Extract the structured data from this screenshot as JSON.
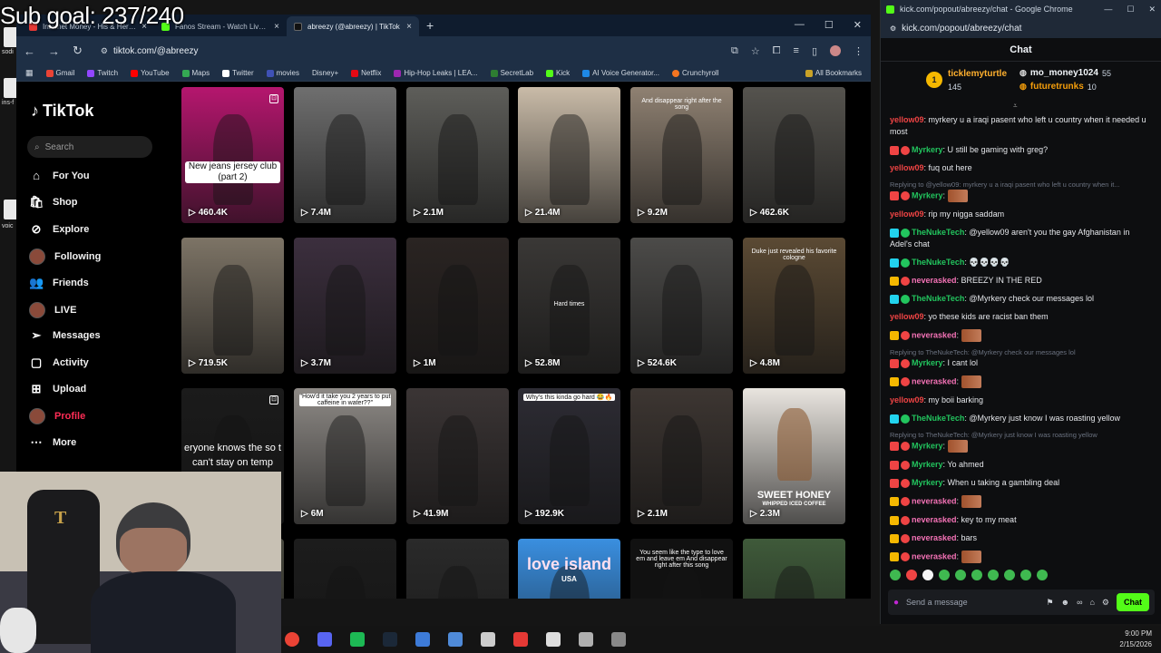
{
  "overlay": {
    "sub_goal": "Sub goal: 237/240"
  },
  "desktop_labels": [
    "ins-f",
    "sodi",
    "voic"
  ],
  "browser": {
    "tabs": [
      {
        "label": "Internet Money - His & Hers ft.",
        "color": "#e53935",
        "active": false
      },
      {
        "label": "Fanos Stream - Watch Live on K",
        "color": "#53fc18",
        "active": false
      },
      {
        "label": "abreezy (@abreezy) | TikTok",
        "color": "#111111",
        "active": true
      }
    ],
    "new_tab": "+",
    "url": "tiktok.com/@abreezy",
    "bookmarks": [
      {
        "label": "Gmail",
        "color": "#ea4335"
      },
      {
        "label": "Twitch",
        "color": "#9146ff"
      },
      {
        "label": "YouTube",
        "color": "#ff0000"
      },
      {
        "label": "Maps",
        "color": "#34a853"
      },
      {
        "label": "Twitter",
        "color": "#ffffff"
      },
      {
        "label": "movies",
        "color": "#3f51b5"
      },
      {
        "label": "Disney+",
        "color": "#113ccf"
      },
      {
        "label": "Netflix",
        "color": "#e50914"
      },
      {
        "label": "Hip-Hop Leaks | LEA...",
        "color": "#9c27b0"
      },
      {
        "label": "SecretLab",
        "color": "#2e7d32"
      },
      {
        "label": "Kick",
        "color": "#53fc18"
      },
      {
        "label": "AI Voice Generator...",
        "color": "#1e88e5"
      },
      {
        "label": "Crunchyroll",
        "color": "#f47521"
      }
    ],
    "all_bookmarks": "All Bookmarks"
  },
  "tiktok": {
    "logo": "TikTok",
    "search_placeholder": "Search",
    "nav": [
      {
        "label": "For You",
        "icon": "home-icon"
      },
      {
        "label": "Shop",
        "icon": "shop-icon"
      },
      {
        "label": "Explore",
        "icon": "compass-icon"
      },
      {
        "label": "Following",
        "icon": "avatar-icon"
      },
      {
        "label": "Friends",
        "icon": "friends-icon"
      },
      {
        "label": "LIVE",
        "icon": "avatar-icon"
      },
      {
        "label": "Messages",
        "icon": "send-icon"
      },
      {
        "label": "Activity",
        "icon": "bell-icon"
      },
      {
        "label": "Upload",
        "icon": "plus-square-icon"
      },
      {
        "label": "Profile",
        "icon": "avatar-icon"
      },
      {
        "label": "More",
        "icon": "more-icon"
      }
    ],
    "videos": [
      {
        "views": "460.4K",
        "bg": "#b5166e",
        "caption": "New jeans jersey club (part 2)"
      },
      {
        "views": "7.4M",
        "bg": "#6f6f6f"
      },
      {
        "views": "2.1M",
        "bg": "#5e5e5a"
      },
      {
        "views": "21.4M",
        "bg": "#c9bba8"
      },
      {
        "views": "9.2M",
        "bg": "#8f8172",
        "top": "And disappear right after the song"
      },
      {
        "views": "462.6K",
        "bg": "#55534e"
      },
      {
        "views": "719.5K",
        "bg": "#7d7466"
      },
      {
        "views": "3.7M",
        "bg": "#3c2f3e"
      },
      {
        "views": "1M",
        "bg": "#2a2422"
      },
      {
        "views": "52.8M",
        "bg": "#3a3836",
        "mid": "Hard times"
      },
      {
        "views": "524.6K",
        "bg": "#4c4b49"
      },
      {
        "views": "4.8M",
        "bg": "#5b4a34",
        "top": "Duke just revealed his favorite cologne"
      },
      {
        "views": "",
        "bg": "#1b1b1b",
        "midwhite": "eryone knows the so t can't stay on temp"
      },
      {
        "views": "6M",
        "bg": "#8e8a86",
        "caption2": "\"How'd it take you 2 years to put caffeine in water??\""
      },
      {
        "views": "41.9M",
        "bg": "#3b3535"
      },
      {
        "views": "192.9K",
        "bg": "#2d2c34",
        "caption2": "Why's this kinda go hard 😂🔥"
      },
      {
        "views": "2.1M",
        "bg": "#3d3632"
      },
      {
        "views": "2.3M",
        "bg": "#e9e5df",
        "big": "SWEET HONEY",
        "small": "WHIPPED ICED COFFEE"
      },
      {
        "views": "",
        "bg": "#49493f"
      },
      {
        "views": "",
        "bg": "#1c1c1c"
      },
      {
        "views": "",
        "bg": "#2a2a2a"
      },
      {
        "views": "",
        "bg": "#3a8fe0",
        "big2": "love island",
        "small2": "USA"
      },
      {
        "views": "",
        "bg": "#111111",
        "top": "You seem like the type to love em and leave em And disappear right after this song"
      },
      {
        "views": "",
        "bg": "#3f5a3a"
      }
    ]
  },
  "chat": {
    "window_title": "kick.com/popout/abreezy/chat - Google Chrome",
    "url": "kick.com/popout/abreezy/chat",
    "header": "Chat",
    "leaderboard": {
      "top": {
        "name": "ticklemyturtle",
        "amount": "145"
      },
      "second": {
        "name": "mo_money1024",
        "amount": "55"
      },
      "third": {
        "name": "futuretrunks",
        "amount": "10"
      }
    },
    "messages": [
      {
        "user": "yellow09",
        "color": "#ef4444",
        "text": ": myrkery u a iraqi pasent who left u country when it needed u most"
      },
      {
        "user": "Myrkery",
        "color": "#22c55e",
        "text": ": U still be gaming with greg?"
      },
      {
        "user": "yellow09",
        "color": "#ef4444",
        "text": ": fuq out here"
      },
      {
        "reply": "Replying to @yellow09: myrkery u a iraqi pasent who left u country when it..."
      },
      {
        "user": "Myrkery",
        "color": "#22c55e",
        "text": ":",
        "emote": true
      },
      {
        "user": "yellow09",
        "color": "#ef4444",
        "text": ": rip my nigga saddam"
      },
      {
        "user": "TheNukeTech",
        "color": "#22c55e",
        "text": ": @yellow09 aren't you the gay Afghanistan in Adel's chat"
      },
      {
        "user": "TheNukeTech",
        "color": "#22c55e",
        "text": ": 💀💀💀💀"
      },
      {
        "user": "neverasked",
        "color": "#f472b6",
        "text": ": BREEZY IN THE RED"
      },
      {
        "user": "TheNukeTech",
        "color": "#22c55e",
        "text": ": @Myrkery check our messages lol"
      },
      {
        "user": "yellow09",
        "color": "#ef4444",
        "text": ": yo these kids are racist ban them"
      },
      {
        "user": "neverasked",
        "color": "#f472b6",
        "text": ":",
        "emote": true
      },
      {
        "reply": "Replying to TheNukeTech: @Myrkery check our messages lol"
      },
      {
        "user": "Myrkery",
        "color": "#22c55e",
        "text": ": I cant lol"
      },
      {
        "user": "neverasked",
        "color": "#f472b6",
        "text": ":",
        "emote": true
      },
      {
        "user": "yellow09",
        "color": "#ef4444",
        "text": ": my boii barking"
      },
      {
        "user": "TheNukeTech",
        "color": "#22c55e",
        "text": ": @Myrkery just know I was roasting yellow"
      },
      {
        "reply": "Replying to TheNukeTech: @Myrkery just know I was roasting yellow"
      },
      {
        "user": "Myrkery",
        "color": "#22c55e",
        "text": ":",
        "emote": true
      },
      {
        "user": "Myrkery",
        "color": "#22c55e",
        "text": ": Yo ahmed"
      },
      {
        "user": "Myrkery",
        "color": "#22c55e",
        "text": ": When u taking a gambling deal"
      },
      {
        "user": "neverasked",
        "color": "#f472b6",
        "text": ":",
        "emote": true
      },
      {
        "user": "neverasked",
        "color": "#f472b6",
        "text": ": key to my meat"
      },
      {
        "user": "neverasked",
        "color": "#f472b6",
        "text": ": bars"
      },
      {
        "user": "neverasked",
        "color": "#f472b6",
        "text": ":",
        "emote": true
      }
    ],
    "input_placeholder": "Send a message",
    "chat_button": "Chat"
  },
  "taskbar": {
    "icons": [
      "chrome-icon",
      "discord-icon",
      "spotify-icon",
      "steam-icon",
      "files-icon",
      "notepad-icon",
      "obs-icon",
      "redapp-icon",
      "mountain-icon",
      "photos-icon",
      "usb-icon"
    ],
    "time": "9:00 PM",
    "date": "2/15/2026"
  }
}
